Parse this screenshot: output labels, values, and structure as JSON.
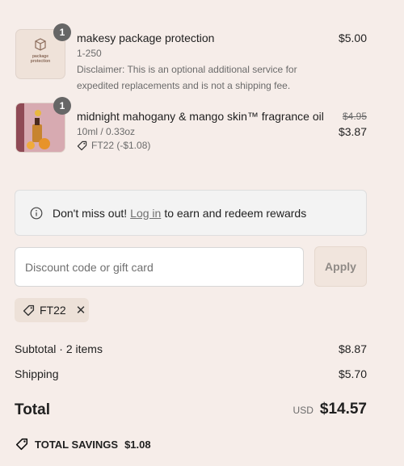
{
  "items": [
    {
      "thumb_text": "package\nprotection",
      "quantity": "1",
      "name": "makesy package protection",
      "variant": "1-250",
      "disclaimer_line1": "Disclaimer: This is an optional additional service for",
      "disclaimer_line2": "expedited replacements and is not a shipping fee.",
      "price": "$5.00"
    },
    {
      "quantity": "1",
      "name": "midnight mahogany & mango skin™ fragrance oil",
      "variant": "10ml / 0.33oz",
      "discount_tag": "FT22 (-$1.08)",
      "original_price": "$4.95",
      "price": "$3.87"
    }
  ],
  "rewards": {
    "prefix": "Don't miss out!",
    "link": "Log in",
    "suffix": "to earn and redeem rewards"
  },
  "discount": {
    "placeholder": "Discount code or gift card",
    "apply_label": "Apply",
    "applied_code": "FT22"
  },
  "summary": {
    "subtotal_label": "Subtotal · 2 items",
    "subtotal_value": "$8.87",
    "shipping_label": "Shipping",
    "shipping_value": "$5.70",
    "total_label": "Total",
    "currency": "USD",
    "total_value": "$14.57",
    "savings_label": "TOTAL SAVINGS",
    "savings_value": "$1.08"
  }
}
